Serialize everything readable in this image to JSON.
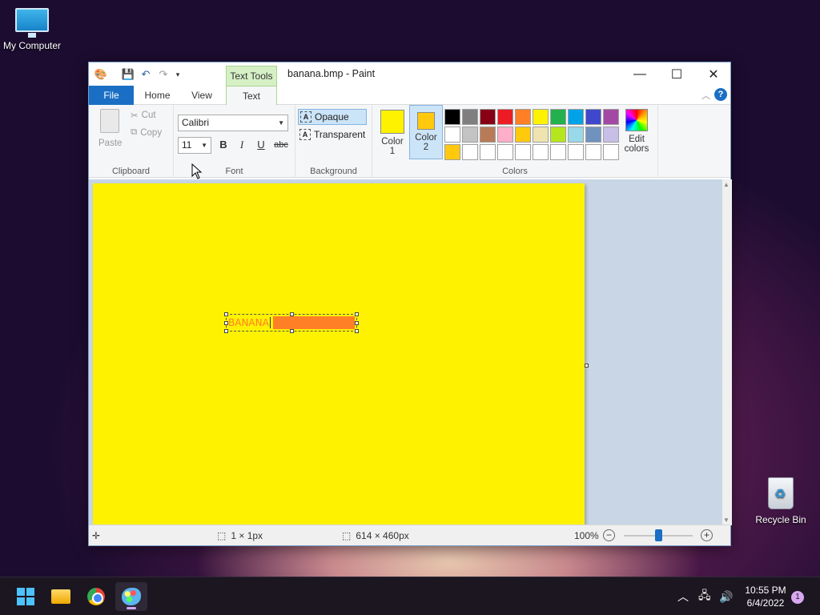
{
  "desktop": {
    "my_computer": "My Computer",
    "recycle_bin": "Recycle Bin"
  },
  "window": {
    "title": "banana.bmp - Paint",
    "context_tab": "Text Tools"
  },
  "tabs": {
    "file": "File",
    "home": "Home",
    "view": "View",
    "text": "Text"
  },
  "ribbon": {
    "clipboard": {
      "label": "Clipboard",
      "paste": "Paste",
      "cut": "Cut",
      "copy": "Copy"
    },
    "font": {
      "label": "Font",
      "family": "Calibri",
      "size": "11",
      "bold": "B",
      "italic": "I",
      "underline": "U",
      "strike": "abc"
    },
    "background": {
      "label": "Background",
      "opaque": "Opaque",
      "transparent": "Transparent"
    },
    "colors": {
      "label": "Colors",
      "color1_line1": "Color",
      "color1_line2": "1",
      "color2_line1": "Color",
      "color2_line2": "2",
      "color1": "#fff200",
      "color2": "#ffc90e",
      "edit_line1": "Edit",
      "edit_line2": "colors",
      "palette": [
        "#000000",
        "#7f7f7f",
        "#880015",
        "#ed1c24",
        "#ff7f27",
        "#fff200",
        "#22b14c",
        "#00a2e8",
        "#3f48cc",
        "#a349a4",
        "#ffffff",
        "#c3c3c3",
        "#b97a57",
        "#ffaec9",
        "#ffc90e",
        "#efe4b0",
        "#b5e61d",
        "#99d9ea",
        "#7092be",
        "#c8bfe7",
        "#ffc90e",
        "#ffffff",
        "#ffffff",
        "#ffffff",
        "#ffffff",
        "#ffffff",
        "#ffffff",
        "#ffffff",
        "#ffffff",
        "#ffffff"
      ]
    }
  },
  "canvas": {
    "background_color": "#fff200",
    "text_content": "BANANA",
    "text_color": "#ff7f27",
    "text_background": "#ff7f27"
  },
  "status": {
    "selection_size": "1 × 1px",
    "image_size": "614 × 460px",
    "zoom": "100%",
    "zoom_level": 0.5
  },
  "taskbar": {
    "time": "10:55 PM",
    "date": "6/4/2022",
    "notifications": "1"
  }
}
